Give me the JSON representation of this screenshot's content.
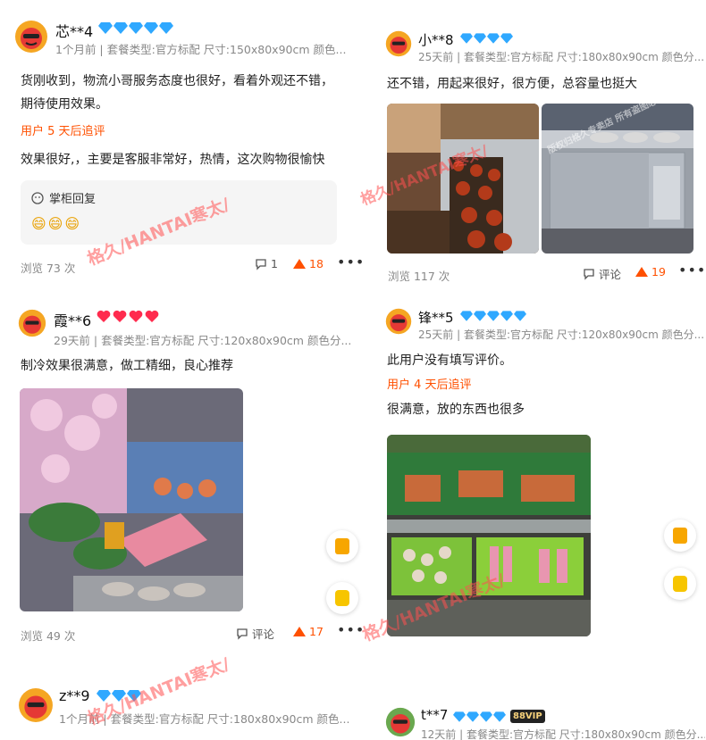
{
  "reviews": [
    {
      "user": "芯**4",
      "meta": "1个月前 | 套餐类型:官方标配 尺寸:150x80x90cm 颜色...",
      "text": "货刚收到，物流小哥服务态度也很好，看着外观还不错，期待使用效果。",
      "followup_label": "用户 5 天后追评",
      "followup_text": "效果很好,，主要是客服非常好，热情，这次购物很愉快",
      "reply_label": "掌柜回复",
      "reply_emoji": "😄😄😄",
      "views": "浏览 73 次",
      "comments": "1",
      "likes": "18"
    },
    {
      "user": "小**8",
      "meta": "25天前 | 套餐类型:官方标配 尺寸:180x80x90cm 颜色分...",
      "text": "还不错，用起来很好，很方便，总容量也挺大",
      "views": "浏览 117 次",
      "comments": "评论",
      "likes": "19"
    },
    {
      "user": "霞**6",
      "meta": "29天前 | 套餐类型:官方标配 尺寸:120x80x90cm 颜色分...",
      "text": "制冷效果很满意，做工精细，良心推荐",
      "views": "浏览 49 次",
      "comments": "评论",
      "likes": "17"
    },
    {
      "user": "锋**5",
      "meta": "25天前 | 套餐类型:官方标配 尺寸:120x80x90cm 颜色分...",
      "text": "此用户没有填写评价。",
      "followup_label": "用户 4 天后追评",
      "followup_text": "很满意，放的东西也很多"
    },
    {
      "user": "z**9",
      "meta": "1个月前 | 套餐类型:官方标配 尺寸:180x80x90cm 颜色..."
    },
    {
      "user": "t**7",
      "meta": "12天前 | 套餐类型:官方标配 尺寸:180x80x90cm 颜色分...",
      "vip": "88VIP"
    }
  ],
  "watermark": "格久/HANTAI寒太/",
  "photo_watermark": "版权归格久专卖店 所有盗图必究",
  "colors": {
    "accent": "#ff5000",
    "diamond": "#2fa8ff",
    "heart": "#ff2b4e"
  },
  "icons": [
    "avatar-icon",
    "diamond-icon",
    "heart-icon",
    "comment-icon",
    "like-icon",
    "more-icon",
    "reply-icon",
    "float-button-icon"
  ]
}
